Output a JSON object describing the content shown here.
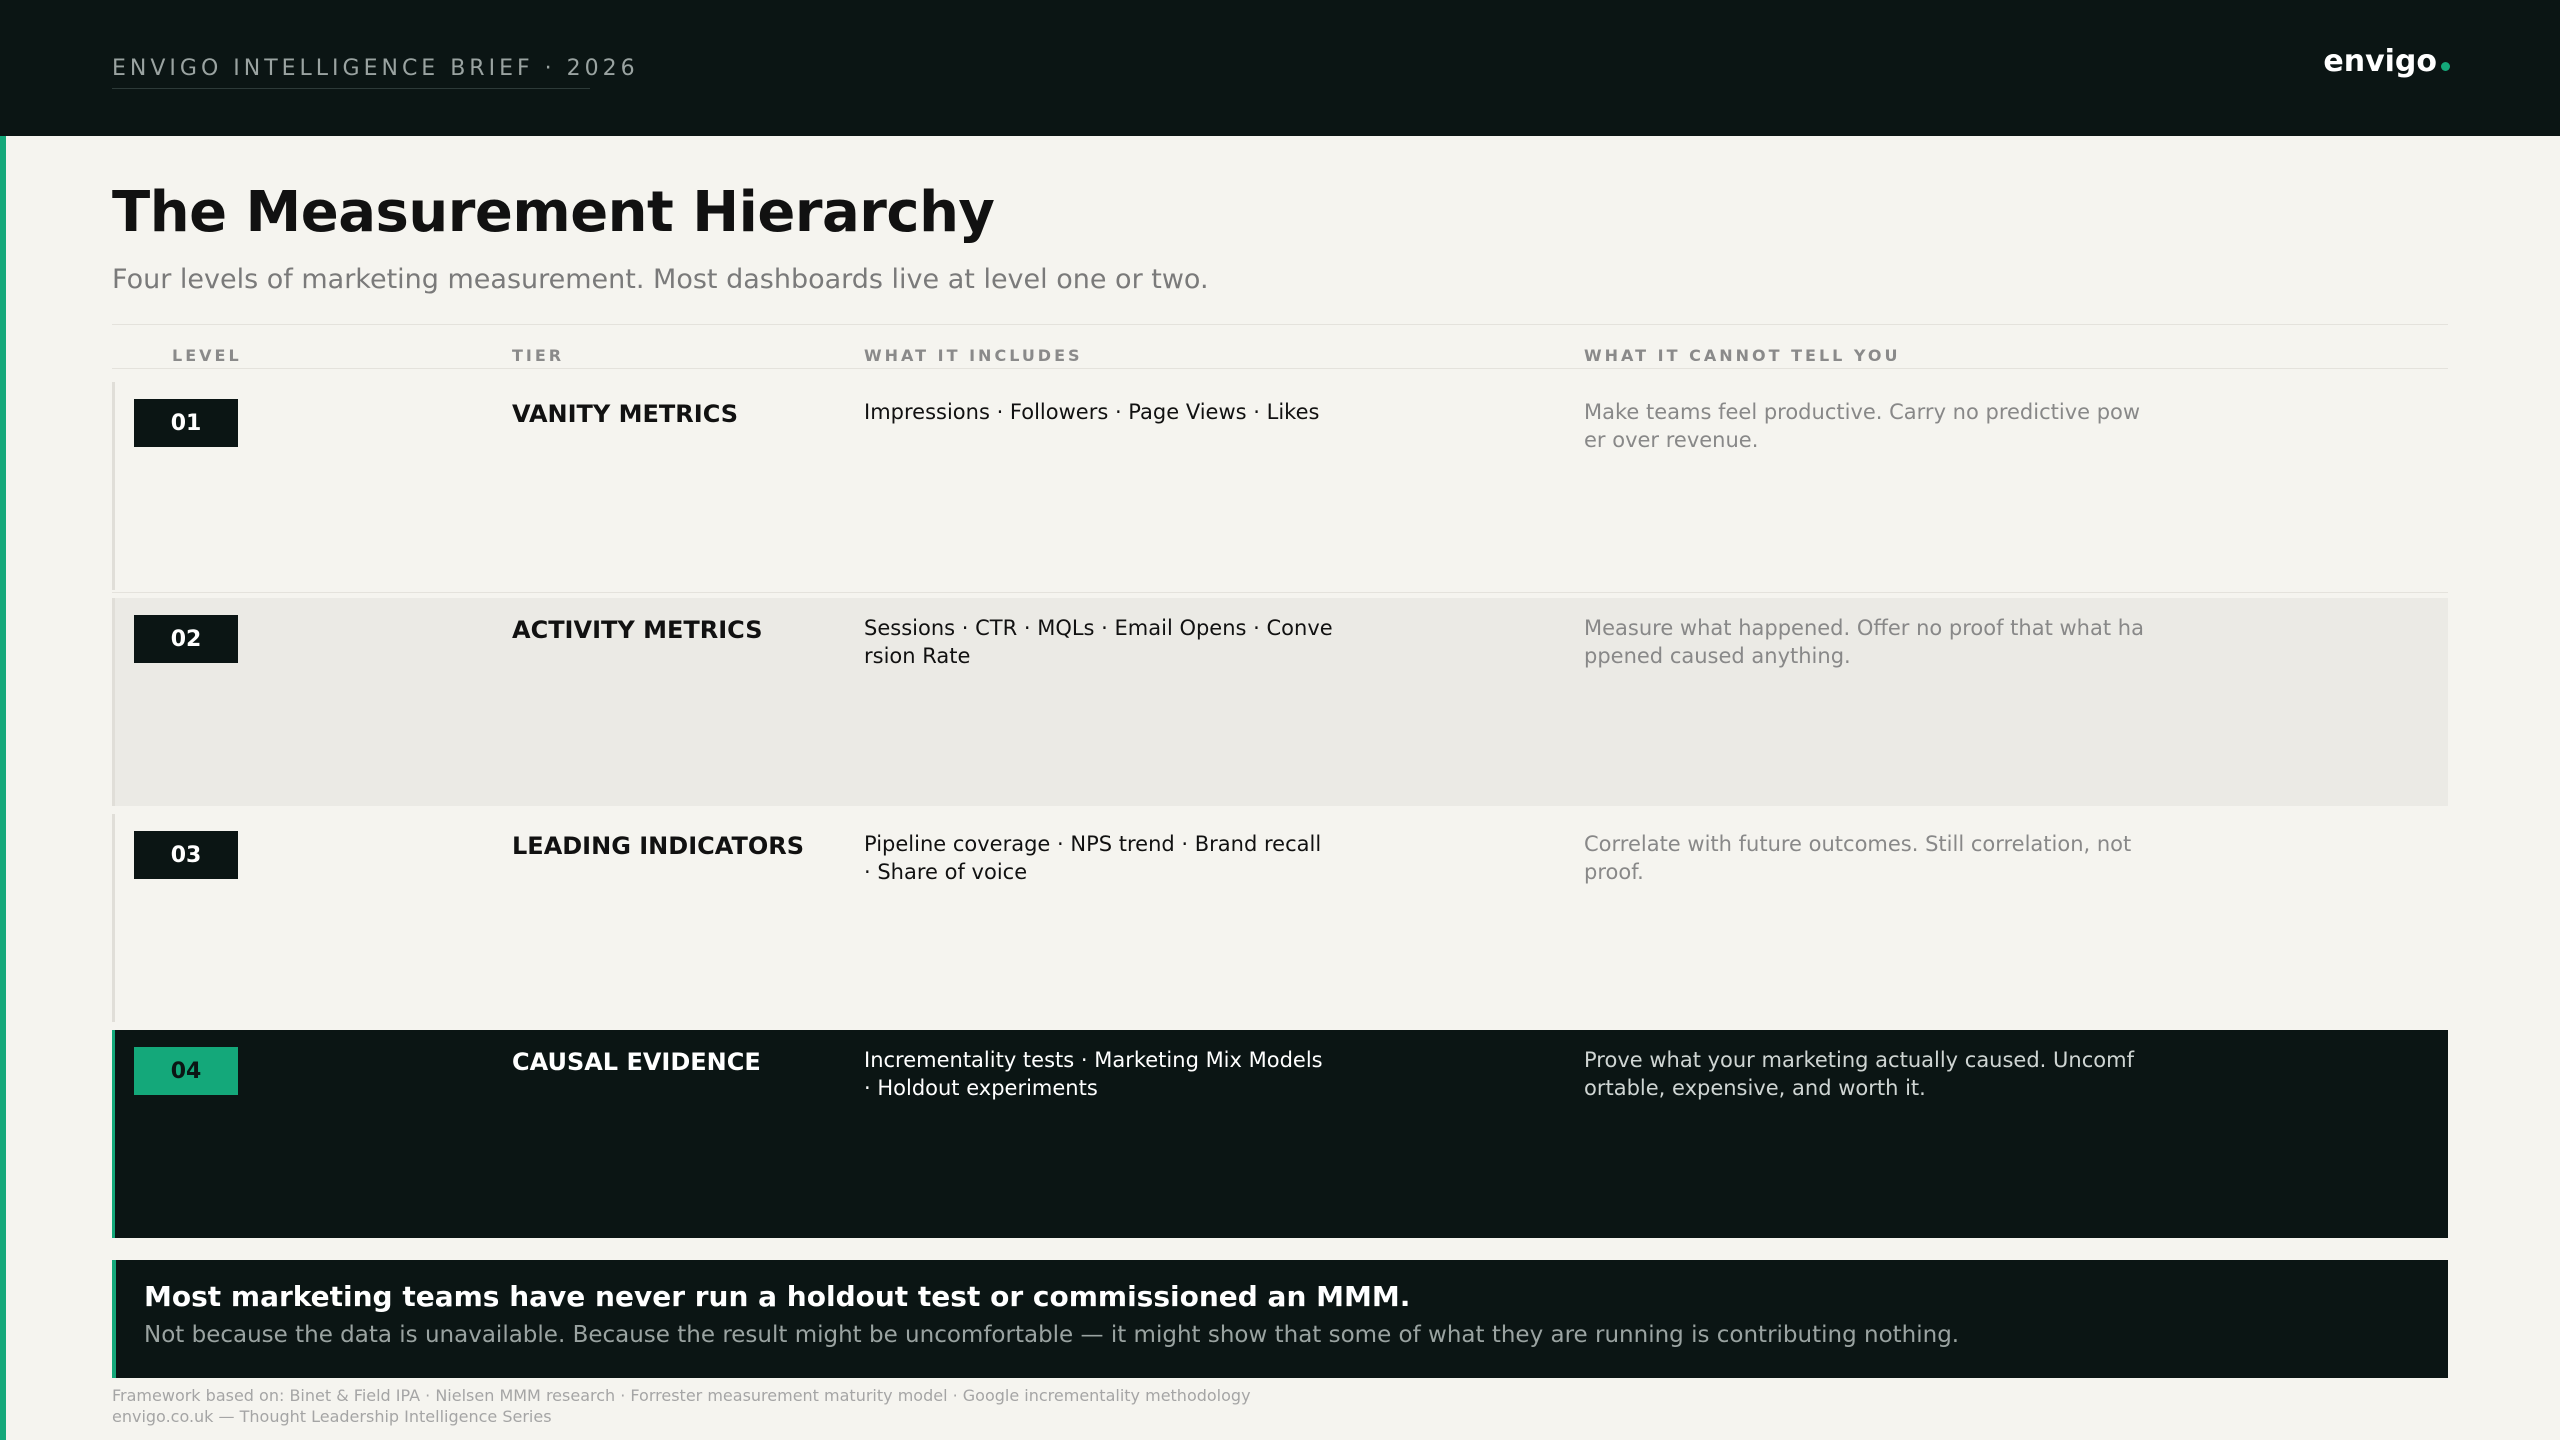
{
  "header": {
    "brief_label": "ENVIGO INTELLIGENCE BRIEF · 2026",
    "logo_text": "envigo"
  },
  "title": "The Measurement Hierarchy",
  "subtitle": "Four levels of marketing measurement. Most dashboards live at level one or two.",
  "table": {
    "columns": [
      "LEVEL",
      "TIER",
      "WHAT IT INCLUDES",
      "WHAT IT CANNOT TELL YOU"
    ],
    "rows": [
      {
        "level": "01",
        "tier": "VANITY METRICS",
        "includes": "Impressions · Followers · Page Views · Likes",
        "cannot": "Make teams feel productive. Carry no predictive power over revenue."
      },
      {
        "level": "02",
        "tier": "ACTIVITY METRICS",
        "includes": "Sessions · CTR · MQLs · Email Opens · Conversion Rate",
        "cannot": "Measure what happened. Offer no proof that what happened caused anything."
      },
      {
        "level": "03",
        "tier": "LEADING INDICATORS",
        "includes": "Pipeline coverage · NPS trend · Brand recall · Share of voice",
        "cannot": "Correlate with future outcomes. Still correlation, not proof."
      },
      {
        "level": "04",
        "tier": "CAUSAL EVIDENCE",
        "includes": "Incrementality tests · Marketing Mix Models · Holdout experiments",
        "cannot": "Prove what your marketing actually caused. Uncomfortable, expensive, and worth it."
      }
    ]
  },
  "callout": {
    "title": "Most marketing teams have never run a holdout test or commissioned an MMM.",
    "subtitle": "Not because the data is unavailable. Because the result might be uncomfortable — it might show that some of what they are running is contributing nothing."
  },
  "footer": {
    "sources": "Framework based on: Binet & Field IPA · Nielsen MMM research · Forrester measurement maturity model · Google incrementality methodology",
    "credit": "envigo.co.uk — Thought Leadership Intelligence Series"
  },
  "colors": {
    "accent": "#14a87a",
    "dark": "#0b1514",
    "background": "#f5f4ef"
  }
}
